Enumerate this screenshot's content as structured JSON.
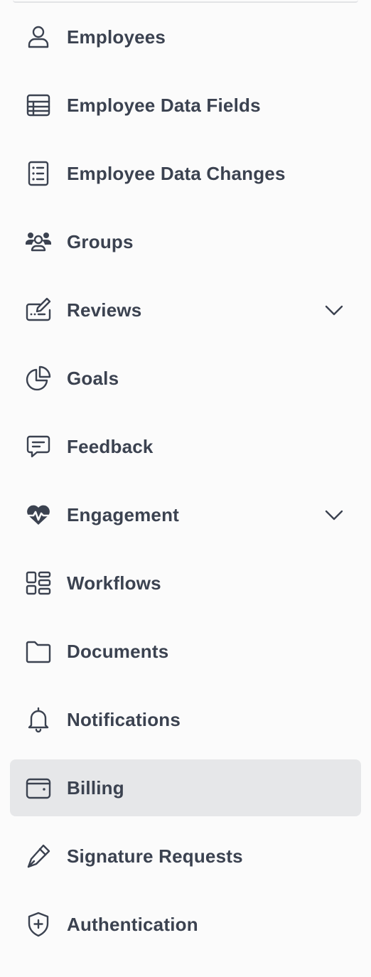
{
  "nav": {
    "items": [
      {
        "label": "Employees",
        "icon": "user-icon",
        "has_chevron": false,
        "active": false
      },
      {
        "label": "Employee Data Fields",
        "icon": "table-icon",
        "has_chevron": false,
        "active": false
      },
      {
        "label": "Employee Data Changes",
        "icon": "list-document-icon",
        "has_chevron": false,
        "active": false
      },
      {
        "label": "Groups",
        "icon": "users-group-icon",
        "has_chevron": false,
        "active": false
      },
      {
        "label": "Reviews",
        "icon": "signature-edit-icon",
        "has_chevron": true,
        "active": false
      },
      {
        "label": "Goals",
        "icon": "pie-chart-icon",
        "has_chevron": false,
        "active": false
      },
      {
        "label": "Feedback",
        "icon": "message-icon",
        "has_chevron": false,
        "active": false
      },
      {
        "label": "Engagement",
        "icon": "heart-pulse-icon",
        "has_chevron": true,
        "active": false
      },
      {
        "label": "Workflows",
        "icon": "layout-grid-icon",
        "has_chevron": false,
        "active": false
      },
      {
        "label": "Documents",
        "icon": "folder-icon",
        "has_chevron": false,
        "active": false
      },
      {
        "label": "Notifications",
        "icon": "bell-icon",
        "has_chevron": false,
        "active": false
      },
      {
        "label": "Billing",
        "icon": "wallet-icon",
        "has_chevron": false,
        "active": true
      },
      {
        "label": "Signature Requests",
        "icon": "pen-icon",
        "has_chevron": false,
        "active": false
      },
      {
        "label": "Authentication",
        "icon": "shield-plus-icon",
        "has_chevron": false,
        "active": false
      }
    ]
  },
  "colors": {
    "text": "#3b4250",
    "active_background": "#e6e7e9",
    "background": "#fbfbfb"
  }
}
